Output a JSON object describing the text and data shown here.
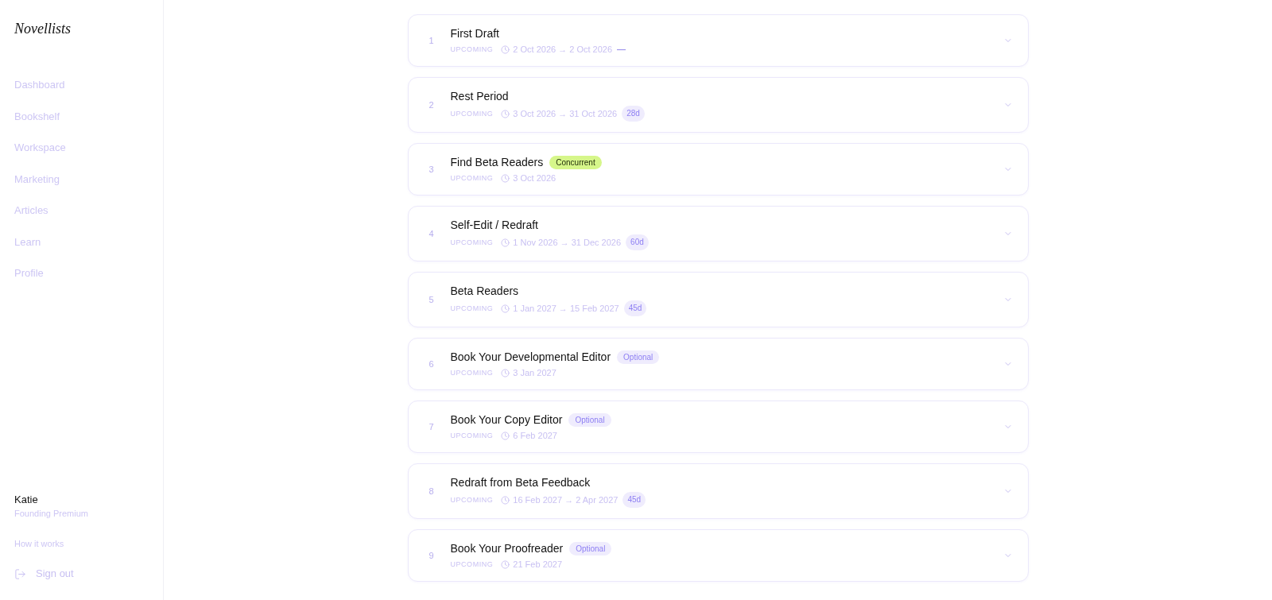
{
  "sidebar": {
    "logo": "Novellists",
    "nav": [
      "Dashboard",
      "Bookshelf",
      "Workspace",
      "Marketing",
      "Articles",
      "Learn",
      "Profile"
    ],
    "user": {
      "name": "Katie",
      "plan": "Founding Premium"
    },
    "help_link": "How it works",
    "sign_out": "Sign out"
  },
  "steps": [
    {
      "number": "1",
      "title": "First Draft",
      "status": "UPCOMING",
      "date": "2 Oct 2026 → 2 Oct 2026",
      "duration": {
        "text": "—",
        "kind": "plain"
      }
    },
    {
      "number": "2",
      "title": "Rest Period",
      "status": "UPCOMING",
      "date": "3 Oct 2026 → 31 Oct 2026",
      "duration": {
        "text": "28d",
        "kind": "pill"
      }
    },
    {
      "number": "3",
      "title": "Find Beta Readers",
      "tag": {
        "label": "Concurrent",
        "kind": "concurrent"
      },
      "status": "UPCOMING",
      "date": "3 Oct 2026"
    },
    {
      "number": "4",
      "title": "Self-Edit / Redraft",
      "status": "UPCOMING",
      "date": "1 Nov 2026 → 31 Dec 2026",
      "duration": {
        "text": "60d",
        "kind": "pill"
      }
    },
    {
      "number": "5",
      "title": "Beta Readers",
      "status": "UPCOMING",
      "date": "1 Jan 2027 → 15 Feb 2027",
      "duration": {
        "text": "45d",
        "kind": "pill"
      }
    },
    {
      "number": "6",
      "title": "Book Your Developmental Editor",
      "tag": {
        "label": "Optional",
        "kind": "optional"
      },
      "status": "UPCOMING",
      "date": "3 Jan 2027"
    },
    {
      "number": "7",
      "title": "Book Your Copy Editor",
      "tag": {
        "label": "Optional",
        "kind": "optional"
      },
      "status": "UPCOMING",
      "date": "6 Feb 2027"
    },
    {
      "number": "8",
      "title": "Redraft from Beta Feedback",
      "status": "UPCOMING",
      "date": "16 Feb 2027 → 2 Apr 2027",
      "duration": {
        "text": "45d",
        "kind": "pill"
      }
    },
    {
      "number": "9",
      "title": "Book Your Proofreader",
      "tag": {
        "label": "Optional",
        "kind": "optional"
      },
      "status": "UPCOMING",
      "date": "21 Feb 2027"
    }
  ]
}
